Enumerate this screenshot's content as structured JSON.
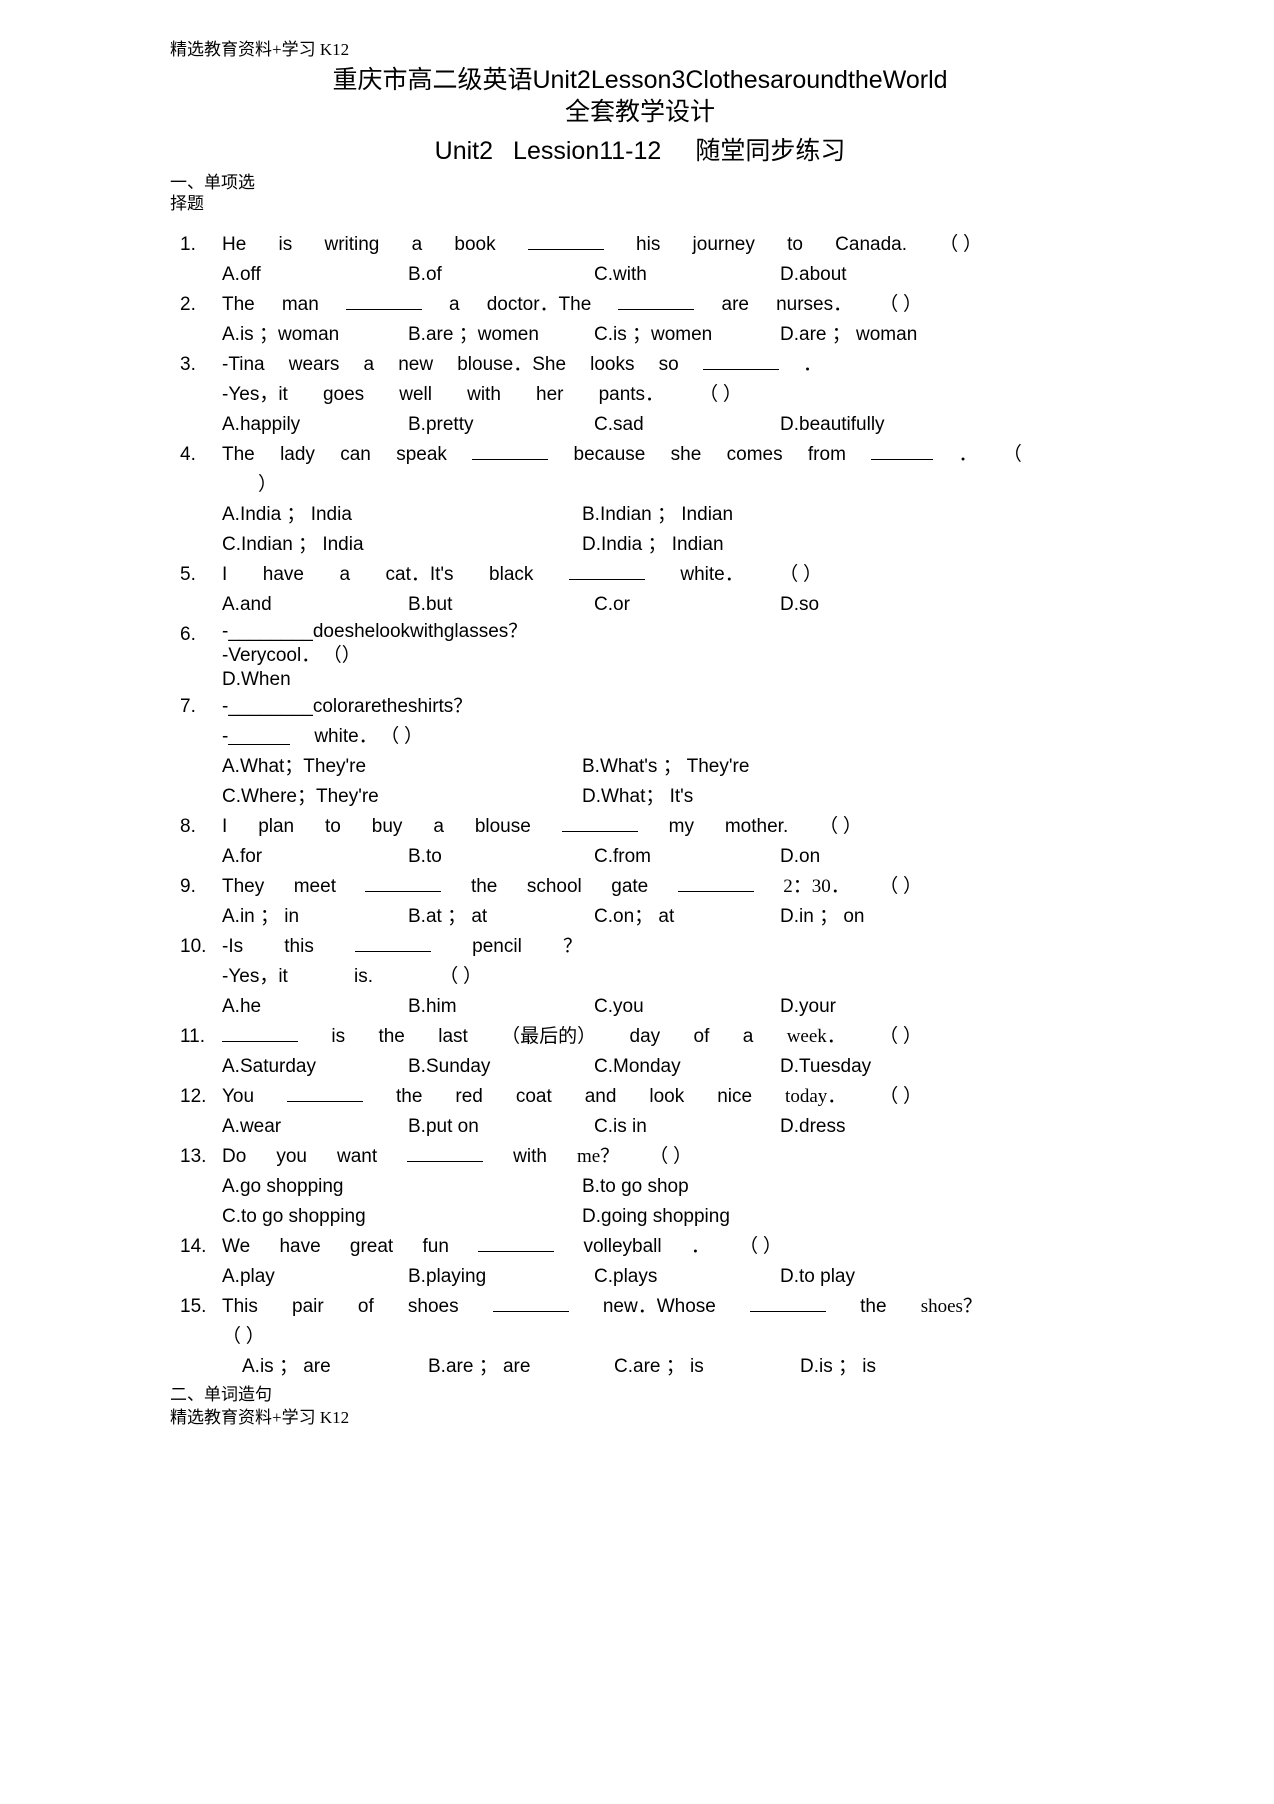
{
  "watermark": {
    "top": "精选教育资料+学习 K12",
    "bottom": "精选教育资料+学习 K12"
  },
  "header": {
    "title_cn": "重庆市高二级英语",
    "title_en": "Unit2Lesson3ClothesaroundtheWorld",
    "subtitle": "全套教学设计",
    "heading_unit": "Unit2",
    "heading_lesson": "Lession11-12",
    "heading_cn": "随堂同步练习"
  },
  "sections": {
    "one_line1": "一、单项选",
    "one_line2": "择题",
    "two": "二、单词造句"
  },
  "questions": [
    {
      "num": "1.",
      "stem_words": [
        "He",
        "is",
        "writing",
        "a",
        "book",
        "____",
        "his",
        "journey",
        "to",
        "Canada."
      ],
      "paren": "（        ）",
      "options": [
        "A.off",
        "B.of",
        "C.with",
        "D.about"
      ]
    },
    {
      "num": "2.",
      "stem_words": [
        "The",
        "man",
        "____",
        "a",
        "doctor．The",
        "____",
        "are",
        "nurses．"
      ],
      "paren": "（        ）",
      "options": [
        "A.is ；woman",
        "B.are ；women",
        "C.is ；women",
        "D.are ； woman"
      ]
    },
    {
      "num": "3.",
      "stem_words": [
        "-Tina",
        "wears",
        "a",
        "new",
        "blouse．She",
        "looks",
        "so",
        "____",
        "．"
      ],
      "stem2_words": [
        "-Yes，it",
        "goes",
        "well",
        "with",
        "her",
        "pants．"
      ],
      "paren": "（        ）",
      "options": [
        "A.happily",
        "B.pretty",
        "C.sad",
        "D.beautifully"
      ]
    },
    {
      "num": "4.",
      "stem_words": [
        "The",
        "lady",
        "can",
        "speak",
        "____",
        "because",
        "she",
        "comes",
        "from",
        "____",
        "．"
      ],
      "paren": "（",
      "paren_close": "）",
      "options_2col": [
        [
          "A.India ； India",
          "B.Indian ； Indian"
        ],
        [
          "C.Indian ； India",
          "D.India ； Indian"
        ]
      ]
    },
    {
      "num": "5.",
      "stem_words": [
        "I",
        "have",
        "a",
        "cat．It's",
        "black",
        "____",
        "white．"
      ],
      "paren": "（        ）",
      "options": [
        "A.and",
        "B.but",
        "C.or",
        "D.so"
      ]
    },
    {
      "num": "6.",
      "compact_line1": "-________doeshelookwithglasses？",
      "compact_line2": "-Verycool．",
      "paren": "（）",
      "compact_line3": "D.When"
    },
    {
      "num": "7.",
      "compact_line1": "-________coloraretheshirts？",
      "stem2_words": [
        "-",
        "____",
        "white．"
      ],
      "paren": "（        ）",
      "options_2col": [
        [
          "A.What；They're",
          "B.What's ； They're"
        ],
        [
          "C.Where；They're",
          "D.What； It's"
        ]
      ]
    },
    {
      "num": "8.",
      "stem_words": [
        "I",
        "plan",
        "to",
        "buy",
        "a",
        "blouse",
        "____",
        "my",
        "mother."
      ],
      "paren": "（        ）",
      "options": [
        "A.for",
        "B.to",
        "C.from",
        "D.on"
      ]
    },
    {
      "num": "9.",
      "stem_words": [
        "They",
        "meet",
        "____",
        "the",
        "school",
        "gate",
        "____",
        "2：30．"
      ],
      "paren": "（        ）",
      "options": [
        "A.in ； in",
        "B.at ； at",
        "C.on； at",
        "D.in ； on"
      ]
    },
    {
      "num": "10.",
      "stem_words": [
        "-Is",
        "this",
        "____",
        "pencil",
        "？"
      ],
      "stem2_words": [
        "-Yes，it",
        "is."
      ],
      "paren": "（        ）",
      "options": [
        "A.he",
        "B.him",
        "C.you",
        "D.your"
      ]
    },
    {
      "num": "11.",
      "stem_words": [
        "____",
        "is",
        "the",
        "last",
        "（最后的）",
        "day",
        "of",
        "a",
        "week．"
      ],
      "paren": "（        ）",
      "options": [
        "A.Saturday",
        "B.Sunday",
        "C.Monday",
        "D.Tuesday"
      ]
    },
    {
      "num": "12.",
      "stem_words": [
        "You",
        "____",
        "the",
        "red",
        "coat",
        "and",
        "look",
        "nice",
        "today．"
      ],
      "paren": "（        ）",
      "options": [
        "A.wear",
        "B.put on",
        "C.is in",
        "D.dress"
      ]
    },
    {
      "num": "13.",
      "stem_words": [
        "Do",
        "you",
        "want",
        "____",
        "with",
        "me？"
      ],
      "paren": "（      ）",
      "options_2col": [
        [
          "A.go shopping",
          "B.to go shop"
        ],
        [
          "C.to go shopping",
          "D.going shopping"
        ]
      ]
    },
    {
      "num": "14.",
      "stem_words": [
        "We",
        "have",
        "great",
        "fun",
        "____",
        "volleyball",
        "．"
      ],
      "paren": "（        ）",
      "options": [
        "A.play",
        "B.playing",
        "C.plays",
        "D.to play"
      ]
    },
    {
      "num": "15.",
      "stem_words": [
        "This",
        "pair",
        "of",
        "shoes",
        "____",
        "new．Whose",
        "____",
        "the",
        "shoes？"
      ],
      "paren": "（        ）",
      "options": [
        "A.is ； are",
        "B.are ； are",
        "C.are ； is",
        "D.is ； is"
      ]
    }
  ]
}
